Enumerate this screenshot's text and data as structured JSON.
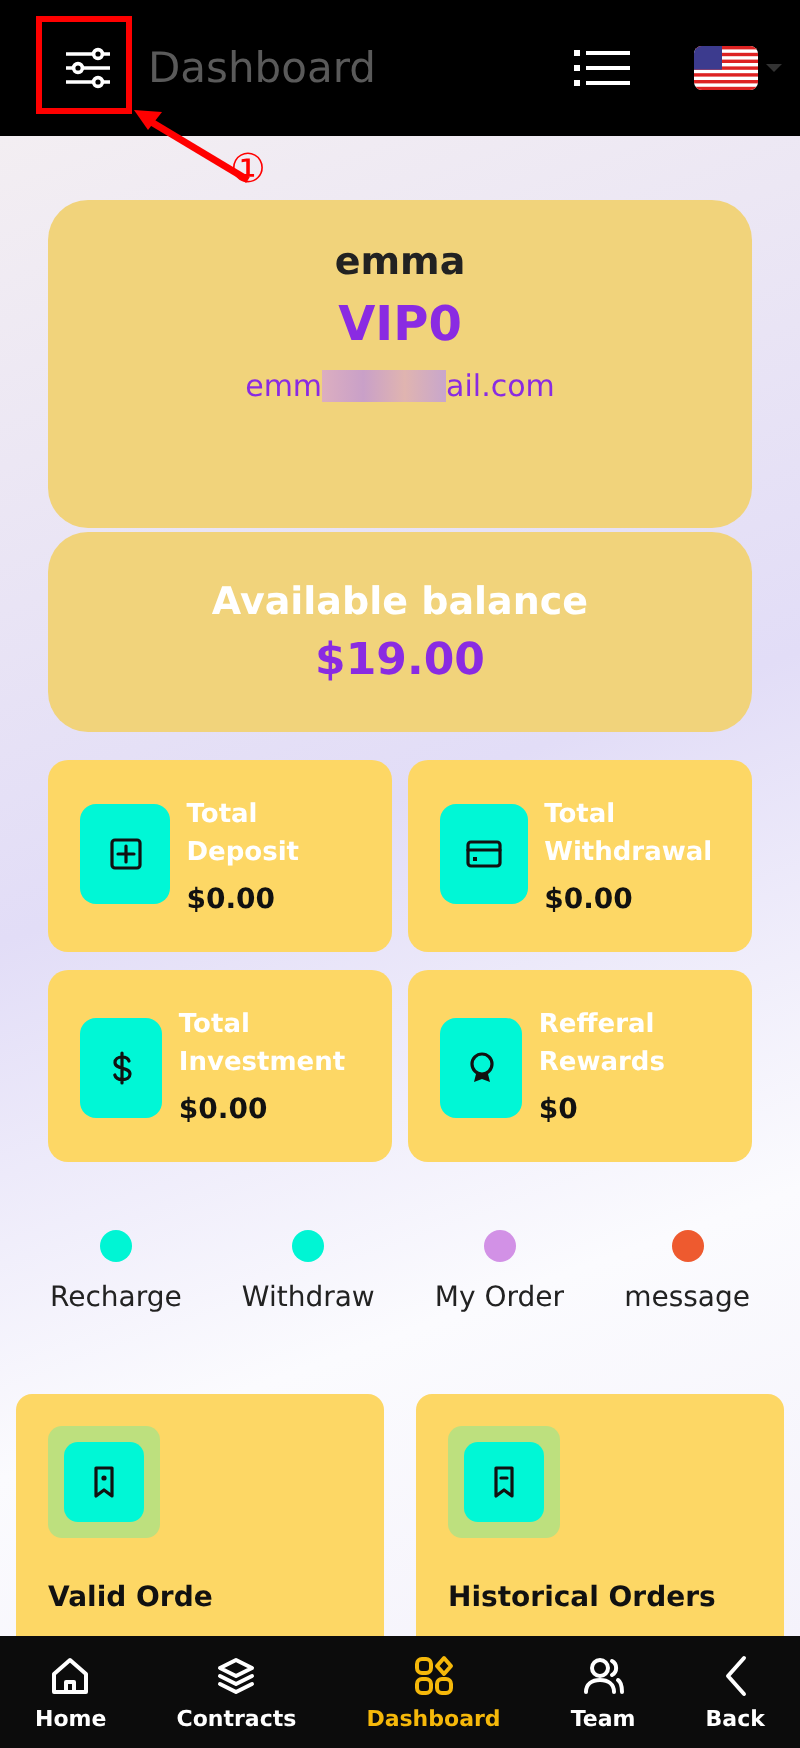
{
  "header": {
    "title": "Dashboard",
    "annotation": "①"
  },
  "profile": {
    "name": "emma",
    "level": "VIP0",
    "email_start": "emm",
    "email_end": "ail.com"
  },
  "balance": {
    "label": "Available balance",
    "amount": "$19.00"
  },
  "stats": [
    {
      "label": "Total Deposit",
      "value": "$0.00"
    },
    {
      "label": "Total Withdrawal",
      "value": "$0.00"
    },
    {
      "label": "Total Investment",
      "value": "$0.00"
    },
    {
      "label": "Refferal Rewards",
      "value": "$0"
    }
  ],
  "quick_links": [
    {
      "label": "Recharge",
      "color": "#00f5d4"
    },
    {
      "label": "Withdraw",
      "color": "#00f5d4"
    },
    {
      "label": "My Order",
      "color": "#d291e6"
    },
    {
      "label": "message",
      "color": "#ee5a2f"
    }
  ],
  "orders": [
    {
      "label": "Valid Orde"
    },
    {
      "label": "Historical Orders"
    }
  ],
  "nav": [
    {
      "label": "Home",
      "selected": false
    },
    {
      "label": "Contracts",
      "selected": false
    },
    {
      "label": "Dashboard",
      "selected": true
    },
    {
      "label": "Team",
      "selected": false
    },
    {
      "label": "Back",
      "selected": false
    }
  ]
}
